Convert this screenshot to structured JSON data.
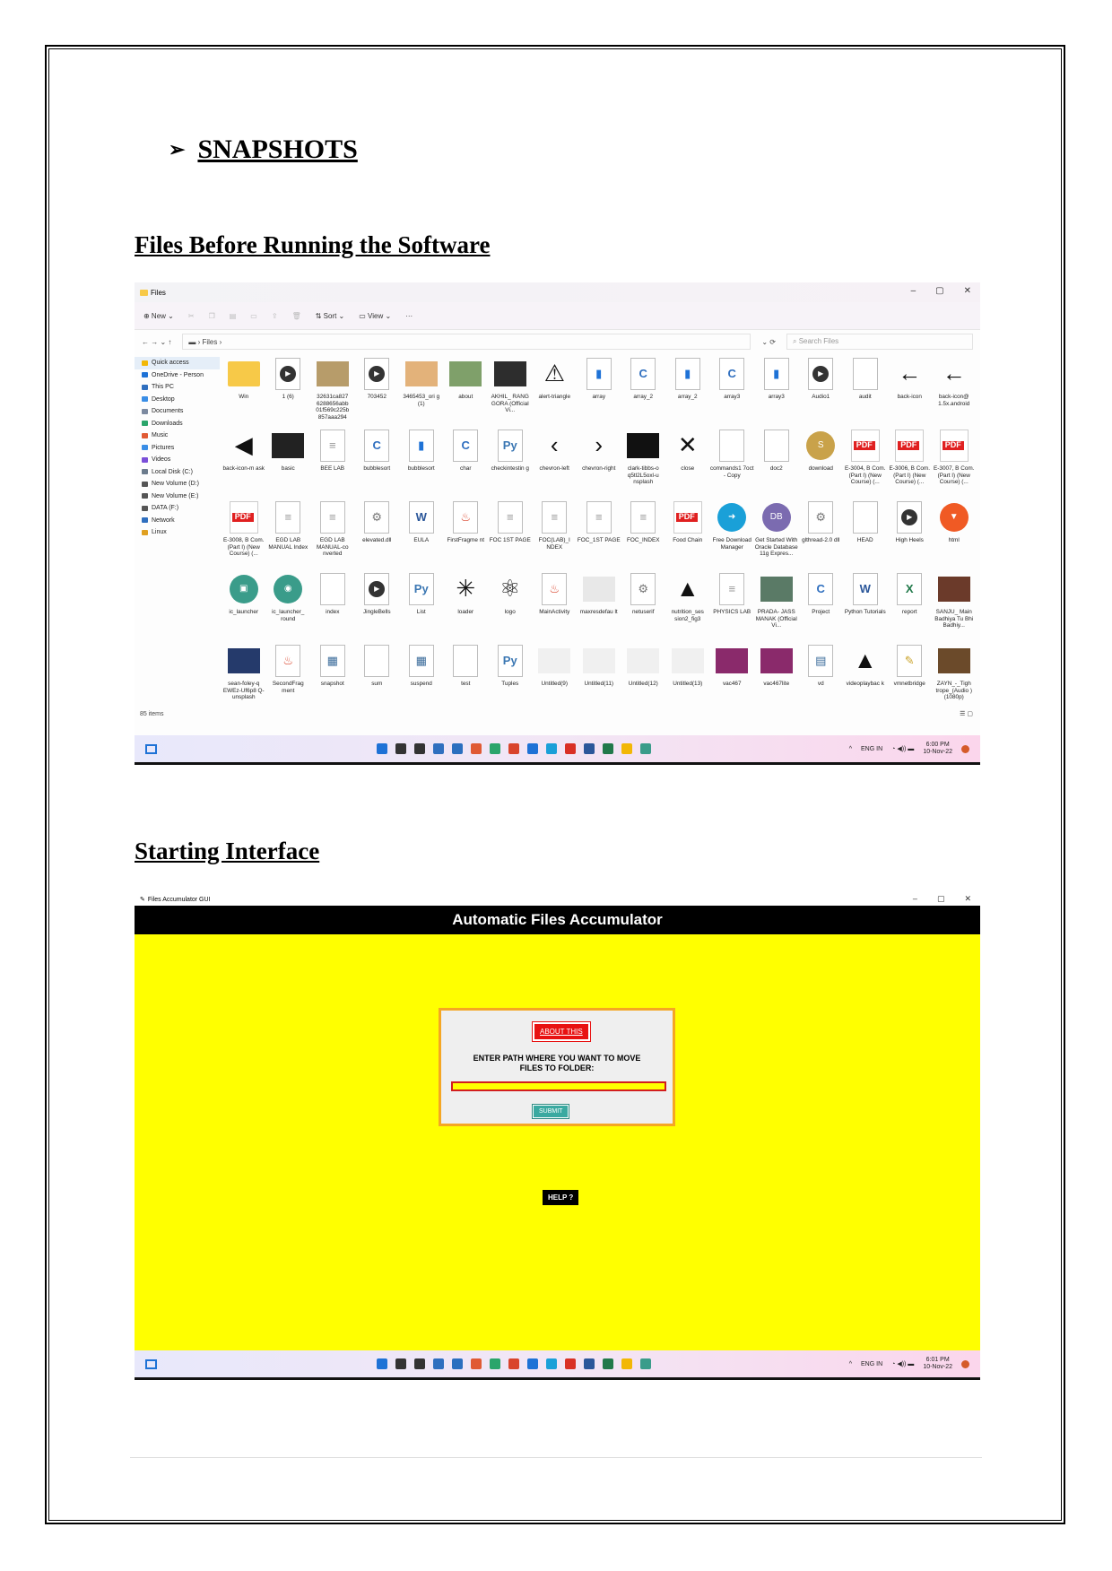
{
  "doc": {
    "heading_marker": "➢",
    "heading": "SNAPSHOTS",
    "section1_title": "Files Before Running the Software",
    "section2_title": "Starting Interface"
  },
  "explorer": {
    "window_title": "Files",
    "controls": [
      "–",
      "▢",
      "✕"
    ],
    "toolbar": {
      "new": "⊕ New ⌄",
      "sort": "⇅ Sort ⌄",
      "view": "▭ View ⌄",
      "more": "···"
    },
    "nav": "←   →   ⌄   ↑",
    "breadcrumb": "▬ › Files ›",
    "refresh": "⌄   ⟳",
    "search_placeholder": "⌕  Search Files",
    "sidebar": [
      {
        "label": "Quick access",
        "color": "#f2b705"
      },
      {
        "label": "OneDrive - Person",
        "color": "#1e72d6"
      },
      {
        "label": "This PC",
        "color": "#2f6fbf"
      },
      {
        "label": "Desktop",
        "color": "#3a8ee6"
      },
      {
        "label": "Documents",
        "color": "#7c8aa0"
      },
      {
        "label": "Downloads",
        "color": "#2aa56b"
      },
      {
        "label": "Music",
        "color": "#e05a34"
      },
      {
        "label": "Pictures",
        "color": "#3a8ee6"
      },
      {
        "label": "Videos",
        "color": "#7a4fd8"
      },
      {
        "label": "Local Disk (C:)",
        "color": "#6b7b8c"
      },
      {
        "label": "New Volume (D:)",
        "color": "#555"
      },
      {
        "label": "New Volume (E:)",
        "color": "#555"
      },
      {
        "label": "DATA (F:)",
        "color": "#555"
      },
      {
        "label": "Network",
        "color": "#2f6fbf"
      },
      {
        "label": "Linux",
        "color": "#e0a020"
      }
    ],
    "items": [
      {
        "label": "Win",
        "kind": "folder"
      },
      {
        "label": "1 (6)",
        "kind": "play"
      },
      {
        "label": "32631ca827 6288656abb 01f569c225b 857aaa294",
        "kind": "img",
        "color": "#b79c6a"
      },
      {
        "label": "703452",
        "kind": "play"
      },
      {
        "label": "3465453_ori g (1)",
        "kind": "img",
        "color": "#e3b27a"
      },
      {
        "label": "about",
        "kind": "img",
        "color": "#7fa06a"
      },
      {
        "label": "AKHIL_ RANG GORA (Official Vi...",
        "kind": "img",
        "color": "#2d2d2d"
      },
      {
        "label": "alert-triangle",
        "kind": "glyph",
        "glyph": "⚠"
      },
      {
        "label": "array",
        "kind": "doc",
        "color": "#1e72d6",
        "glyph": "▮"
      },
      {
        "label": "array_2",
        "kind": "doc",
        "color": "#2f6fbf",
        "glyph": "C"
      },
      {
        "label": "array_2",
        "kind": "doc",
        "color": "#1e72d6",
        "glyph": "▮"
      },
      {
        "label": "array3",
        "kind": "doc",
        "color": "#2f6fbf",
        "glyph": "C"
      },
      {
        "label": "array3",
        "kind": "doc",
        "color": "#1e72d6",
        "glyph": "▮"
      },
      {
        "label": "Audio1",
        "kind": "play"
      },
      {
        "label": "audit",
        "kind": "doc",
        "color": "#aaa",
        "glyph": ""
      },
      {
        "label": "back-icon",
        "kind": "glyph",
        "glyph": "←"
      },
      {
        "label": "back-icon@ 1.5x.android",
        "kind": "glyph",
        "glyph": "←"
      },
      {
        "label": "back-icon-m ask",
        "kind": "glyph",
        "glyph": "◀"
      },
      {
        "label": "basic",
        "kind": "img",
        "color": "#222"
      },
      {
        "label": "BEE LAB",
        "kind": "doc",
        "color": "#999",
        "glyph": "≡"
      },
      {
        "label": "bubblesort",
        "kind": "doc",
        "color": "#2f6fbf",
        "glyph": "C"
      },
      {
        "label": "bubblesort",
        "kind": "doc",
        "color": "#1e72d6",
        "glyph": "▮"
      },
      {
        "label": "char",
        "kind": "doc",
        "color": "#2f6fbf",
        "glyph": "C"
      },
      {
        "label": "checkintestin g",
        "kind": "doc",
        "color": "#3b77b3",
        "glyph": "Py"
      },
      {
        "label": "chevron-left",
        "kind": "glyph",
        "glyph": "‹"
      },
      {
        "label": "chevron-right",
        "kind": "glyph",
        "glyph": "›"
      },
      {
        "label": "clark-tibbs-o q5tl2L5oxl-u nsplash",
        "kind": "img",
        "color": "#111"
      },
      {
        "label": "close",
        "kind": "glyph",
        "glyph": "✕"
      },
      {
        "label": "commands1 7oct - Copy",
        "kind": "doc",
        "color": "#aaa",
        "glyph": ""
      },
      {
        "label": "doc2",
        "kind": "doc",
        "color": "#aaa",
        "glyph": ""
      },
      {
        "label": "download",
        "kind": "circle",
        "color": "#c9a24a",
        "glyph": "S"
      },
      {
        "label": "E-3004, B Com. (Part I) (New Course) (...",
        "kind": "pdf"
      },
      {
        "label": "E-3006, B Com. (Part I) (New Course) (...",
        "kind": "pdf"
      },
      {
        "label": "E-3007, B Com. (Part I) (New Course) (...",
        "kind": "pdf"
      },
      {
        "label": "E-3008, B Com. (Part I) (New Course) (...",
        "kind": "pdf"
      },
      {
        "label": "EGD LAB MANUAL Index",
        "kind": "doc",
        "color": "#999",
        "glyph": "≡"
      },
      {
        "label": "EGD LAB MANUAL-co nverted",
        "kind": "doc",
        "color": "#999",
        "glyph": "≡"
      },
      {
        "label": "elevated.dll",
        "kind": "doc",
        "color": "#777",
        "glyph": "⚙"
      },
      {
        "label": "EULA",
        "kind": "doc",
        "color": "#2b579a",
        "glyph": "W"
      },
      {
        "label": "FirstFragme nt",
        "kind": "doc",
        "color": "#d9442c",
        "glyph": "♨"
      },
      {
        "label": "FOC 1ST PAGE",
        "kind": "doc",
        "color": "#999",
        "glyph": "≡"
      },
      {
        "label": "FOC(LAB)_I NDEX",
        "kind": "doc",
        "color": "#999",
        "glyph": "≡"
      },
      {
        "label": "FOC_1ST PAGE",
        "kind": "doc",
        "color": "#999",
        "glyph": "≡"
      },
      {
        "label": "FOC_INDEX",
        "kind": "doc",
        "color": "#999",
        "glyph": "≡"
      },
      {
        "label": "Food Chain",
        "kind": "pdf"
      },
      {
        "label": "Free Download Manager",
        "kind": "circle",
        "color": "#1aa0d8",
        "glyph": "➜"
      },
      {
        "label": "Get Started With Oracle Database 11g Expres...",
        "kind": "circle",
        "color": "#7b6bb0",
        "glyph": "DB"
      },
      {
        "label": "glthread-2.0 dll",
        "kind": "doc",
        "color": "#777",
        "glyph": "⚙"
      },
      {
        "label": "HEAD",
        "kind": "doc",
        "color": "#aaa",
        "glyph": ""
      },
      {
        "label": "High Heels",
        "kind": "play"
      },
      {
        "label": "html",
        "kind": "circle",
        "color": "#f05a24",
        "glyph": "▼"
      },
      {
        "label": "ic_launcher",
        "kind": "circle",
        "color": "#3a9c8a",
        "glyph": "▣"
      },
      {
        "label": "ic_launcher_ round",
        "kind": "circle",
        "color": "#3a9c8a",
        "glyph": "◉"
      },
      {
        "label": "index",
        "kind": "doc",
        "color": "#aaa",
        "glyph": ""
      },
      {
        "label": "JingleBells",
        "kind": "play"
      },
      {
        "label": "List",
        "kind": "doc",
        "color": "#3b77b3",
        "glyph": "Py"
      },
      {
        "label": "loader",
        "kind": "glyph",
        "glyph": "✳"
      },
      {
        "label": "logo",
        "kind": "glyph",
        "glyph": "⚛"
      },
      {
        "label": "MainActivity",
        "kind": "doc",
        "color": "#d9442c",
        "glyph": "♨"
      },
      {
        "label": "maxresdefau lt",
        "kind": "img",
        "color": "#e8e8e8"
      },
      {
        "label": "netuserif",
        "kind": "doc",
        "color": "#777",
        "glyph": "⚙"
      },
      {
        "label": "nutrition_ses sion2_fig3",
        "kind": "glyph",
        "glyph": "▲"
      },
      {
        "label": "PHYSICS LAB",
        "kind": "doc",
        "color": "#999",
        "glyph": "≡"
      },
      {
        "label": "PRADA- JASS MANAK (Official Vi...",
        "kind": "img",
        "color": "#5a7a66"
      },
      {
        "label": "Project",
        "kind": "doc",
        "color": "#2f6fbf",
        "glyph": "C"
      },
      {
        "label": "Python Tutorials",
        "kind": "doc",
        "color": "#2b579a",
        "glyph": "W"
      },
      {
        "label": "report",
        "kind": "doc",
        "color": "#21794a",
        "glyph": "X"
      },
      {
        "label": "SANJU_ Main Badhiya Tu Bhi Badhiy...",
        "kind": "img",
        "color": "#6b3a2a"
      },
      {
        "label": "sean-foley-q EWEz-Uf6p8 Q-unsplash",
        "kind": "img",
        "color": "#253a6b"
      },
      {
        "label": "SecondFrag ment",
        "kind": "doc",
        "color": "#d9442c",
        "glyph": "♨"
      },
      {
        "label": "snapshot",
        "kind": "doc",
        "color": "#3a6b9a",
        "glyph": "▦"
      },
      {
        "label": "sum",
        "kind": "doc",
        "color": "#aaa",
        "glyph": ""
      },
      {
        "label": "suspend",
        "kind": "doc",
        "color": "#3a6b9a",
        "glyph": "▦"
      },
      {
        "label": "test",
        "kind": "doc",
        "color": "#ddd",
        "glyph": ""
      },
      {
        "label": "Tuples",
        "kind": "doc",
        "color": "#3b77b3",
        "glyph": "Py"
      },
      {
        "label": "Untitled(9)",
        "kind": "img",
        "color": "#f0f0f0"
      },
      {
        "label": "Untitled(11)",
        "kind": "img",
        "color": "#f0f0f0"
      },
      {
        "label": "Untitled(12)",
        "kind": "img",
        "color": "#f0f0f0"
      },
      {
        "label": "Untitled(13)",
        "kind": "img",
        "color": "#f0f0f0"
      },
      {
        "label": "vac467",
        "kind": "img",
        "color": "#8a2a6b"
      },
      {
        "label": "vac467lite",
        "kind": "img",
        "color": "#8a2a6b"
      },
      {
        "label": "vd",
        "kind": "doc",
        "color": "#3a6b9a",
        "glyph": "▤"
      },
      {
        "label": "videoplaybac k",
        "kind": "glyph",
        "glyph": "▲"
      },
      {
        "label": "vmnetbridge",
        "kind": "doc",
        "color": "#c9a227",
        "glyph": "✎"
      },
      {
        "label": "ZAYN_-_Tigh trope_(Audio )(1080p)",
        "kind": "img",
        "color": "#6b4a2a"
      }
    ],
    "status": "85 items",
    "view_toggle": "☰ ▢",
    "taskbar": {
      "icon_colors": [
        "#1e72d6",
        "#333",
        "#333",
        "#2f6fbf",
        "#2b6fbf",
        "#e05a34",
        "#2aa56b",
        "#d9442c",
        "#1e72d6",
        "#1aa0d8",
        "#d93025",
        "#2b579a",
        "#21794a",
        "#f2b705",
        "#3a9c8a"
      ],
      "lang": "ENG IN",
      "time": "6:00 PM",
      "date": "10-Nov-22"
    }
  },
  "gui": {
    "window_title": "Files Accumulator GUI",
    "header": "Automatic Files Accumulator",
    "about_button": "ABOUT THIS",
    "prompt_line1": "ENTER PATH WHERE YOU WANT TO MOVE",
    "prompt_line2": "FILES TO FOLDER:",
    "path_value": "",
    "submit_button": "SUBMIT",
    "help_button": "HELP ?",
    "taskbar": {
      "lang": "ENG IN",
      "time": "6:01 PM",
      "date": "10-Nov-22"
    }
  }
}
